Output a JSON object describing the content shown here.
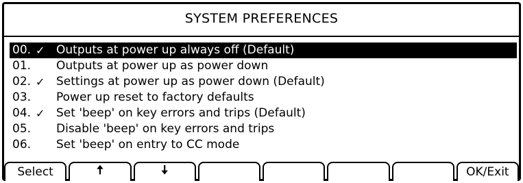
{
  "title": "SYSTEM PREFERENCES",
  "options": [
    {
      "num": "00.",
      "check": "✓",
      "text": "Outputs at power up always off (Default)",
      "selected": true
    },
    {
      "num": "01.",
      "check": "",
      "text": "Outputs at power up as power down",
      "selected": false
    },
    {
      "num": "02.",
      "check": "✓",
      "text": "Settings at power up as power down (Default)",
      "selected": false
    },
    {
      "num": "03.",
      "check": "",
      "text": "Power up reset to factory defaults",
      "selected": false
    },
    {
      "num": "04.",
      "check": "✓",
      "text": "Set 'beep' on key errors and trips (Default)",
      "selected": false
    },
    {
      "num": "05.",
      "check": "",
      "text": "Disable 'beep' on key errors and trips",
      "selected": false
    },
    {
      "num": "06.",
      "check": "",
      "text": "Set 'beep' on entry to CC mode",
      "selected": false
    }
  ],
  "softkeys": {
    "select_label": "Select",
    "up_icon": "up-arrow-icon",
    "up_glyph": "🠅",
    "down_icon": "down-arrow-icon",
    "down_glyph": "🠇",
    "ok_exit_label": "OK/Exit"
  }
}
